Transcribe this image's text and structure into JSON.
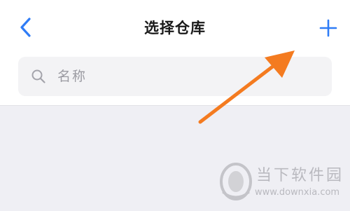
{
  "header": {
    "title": "选择仓库",
    "back_icon": "chevron-left-icon",
    "add_icon": "plus-icon"
  },
  "search": {
    "placeholder": "名称",
    "value": "",
    "icon": "search-icon"
  },
  "annotation": {
    "icon": "orange-arrow-icon",
    "color": "#f47b20"
  },
  "watermark": {
    "name": "当下软件园",
    "url": "www.downxia.com",
    "icon": "downxia-logo-icon"
  },
  "colors": {
    "accent": "#2f7cf6",
    "background": "#efeff4",
    "header_bg": "#ffffff",
    "search_bg": "#f3f3f5",
    "placeholder": "#9b9ba2"
  }
}
